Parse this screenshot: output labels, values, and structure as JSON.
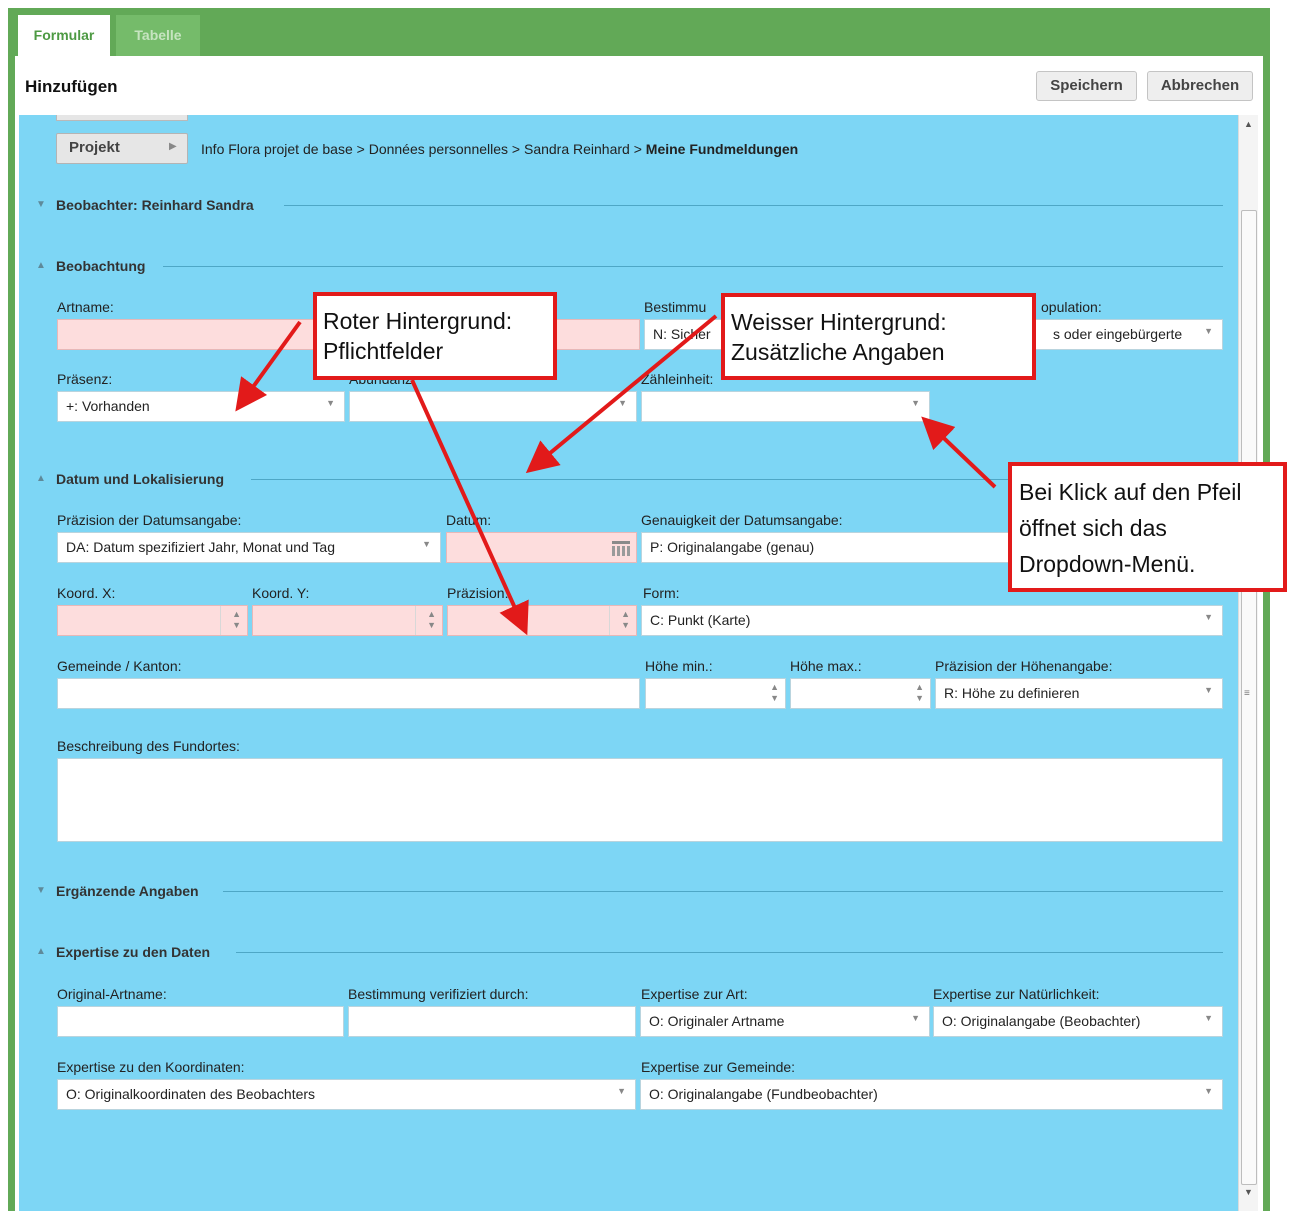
{
  "tabs": [
    {
      "label": "Formular",
      "active": true
    },
    {
      "label": "Tabelle",
      "active": false
    }
  ],
  "header": {
    "title": "Hinzufügen",
    "save_label": "Speichern",
    "cancel_label": "Abbrechen"
  },
  "project": {
    "button_label": "Projekt",
    "breadcrumb": "Info Flora projet de base > Données personnelles > Sandra Reinhard > ",
    "breadcrumb_current": "Meine Fundmeldungen"
  },
  "sections": {
    "beobachter": "Beobachter: Reinhard Sandra",
    "beobachtung": "Beobachtung",
    "datum_lokalisierung": "Datum und Lokalisierung",
    "ergaenzende": "Ergänzende Angaben",
    "expertise": "Expertise zu den Daten"
  },
  "fields": {
    "artname": {
      "label": "Artname:",
      "value": ""
    },
    "bestimmung": {
      "label": "Bestimmu",
      "value": "N: Sicher"
    },
    "population": {
      "label": "opulation:",
      "value": "s oder eingebürgerte"
    },
    "praesenz": {
      "label": "Präsenz:",
      "value": "+: Vorhanden"
    },
    "abundanz": {
      "label": "Abundanz:",
      "value": ""
    },
    "zaehleinheit": {
      "label": "Zähleinheit:",
      "value": ""
    },
    "praezision_datum": {
      "label": "Präzision der Datumsangabe:",
      "value": "DA: Datum spezifiziert Jahr, Monat und Tag"
    },
    "datum": {
      "label": "Datum:",
      "value": ""
    },
    "genauigkeit_datum": {
      "label": "Genauigkeit der Datumsangabe:",
      "value": "P: Originalangabe (genau)"
    },
    "koord_x": {
      "label": "Koord. X:",
      "value": ""
    },
    "koord_y": {
      "label": "Koord. Y:",
      "value": ""
    },
    "praezision": {
      "label": "Präzision:",
      "value": ""
    },
    "form": {
      "label": "Form:",
      "value": "C: Punkt (Karte)"
    },
    "gemeinde": {
      "label": "Gemeinde / Kanton:",
      "value": ""
    },
    "hoehe_min": {
      "label": "Höhe min.:",
      "value": ""
    },
    "hoehe_max": {
      "label": "Höhe max.:",
      "value": ""
    },
    "praezision_hoehe": {
      "label": "Präzision der Höhenangabe:",
      "value": "R: Höhe zu definieren"
    },
    "beschreibung": {
      "label": "Beschreibung des Fundortes:",
      "value": ""
    },
    "original_artname": {
      "label": "Original-Artname:",
      "value": ""
    },
    "bestimmung_verifiziert": {
      "label": "Bestimmung verifiziert durch:",
      "value": ""
    },
    "expertise_art": {
      "label": "Expertise zur Art:",
      "value": "O: Originaler Artname"
    },
    "expertise_natuerlichkeit": {
      "label": "Expertise zur Natürlichkeit:",
      "value": "O: Originalangabe (Beobachter)"
    },
    "expertise_koordinaten": {
      "label": "Expertise zu den Koordinaten:",
      "value": "O: Originalkoordinaten des Beobachters"
    },
    "expertise_gemeinde": {
      "label": "Expertise zur Gemeinde:",
      "value": "O: Originalangabe (Fundbeobachter)"
    }
  },
  "annotations": {
    "roter_line1": "Roter Hintergrund:",
    "roter_line2": "Pflichtfelder",
    "weisser_line1": "Weisser Hintergrund:",
    "weisser_line2": "Zusätzliche Angaben",
    "klick_line1": "Bei Klick auf den Pfeil",
    "klick_line2": "öffnet sich das",
    "klick_line3": "Dropdown-Menü."
  },
  "colors": {
    "frame_green": "#62a957",
    "form_background": "#7dd6f5",
    "required_field": "#fddddd",
    "annotation_red": "#e21a1a"
  },
  "icons": {
    "dropdown": "chevron-down-icon",
    "spinner": "spinner-arrows-icon",
    "calendar": "calendar-icon",
    "collapse": "triangle-icon"
  }
}
